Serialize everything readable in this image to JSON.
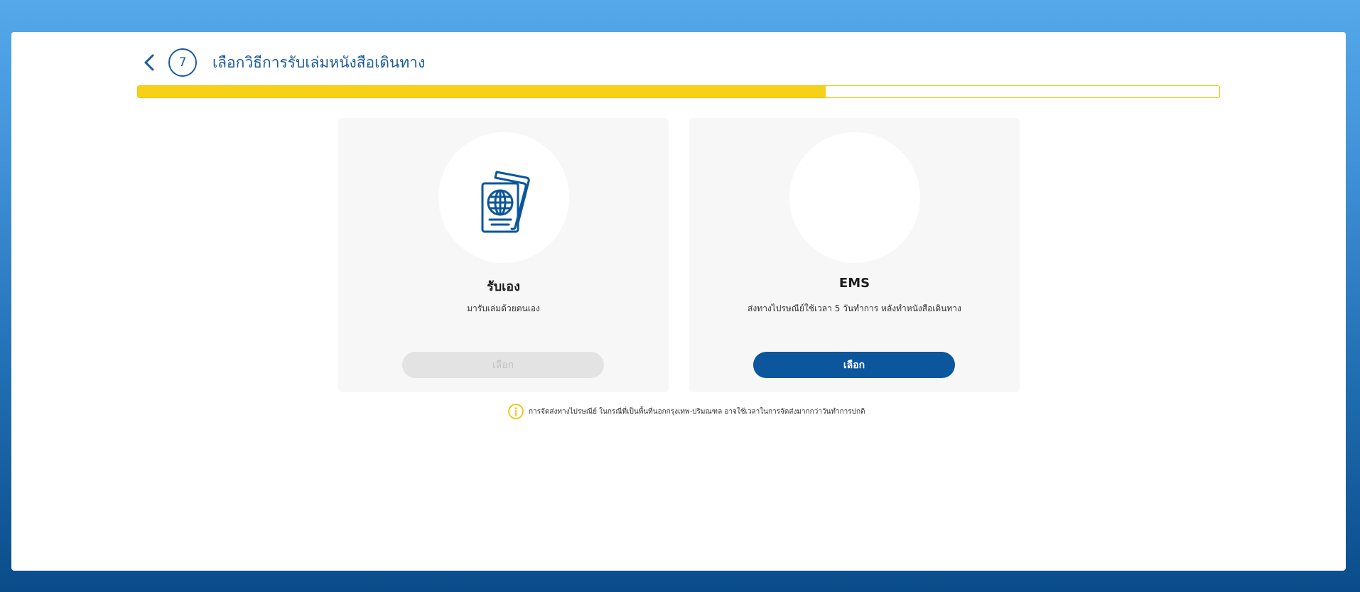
{
  "header": {
    "step_number": "7",
    "title": "เลือกวิธีการรับเล่มหนังสือเดินทาง"
  },
  "progress": {
    "fraction": 0.636,
    "fill_color": "#f7d117",
    "border_color": "#f4c20d"
  },
  "options": [
    {
      "title": "รับเอง",
      "description": "มารับเล่มด้วยตนเอง",
      "button_label": "เลือก",
      "button_state": "disabled",
      "icon": "passport-icon"
    },
    {
      "title": "EMS",
      "description": "ส่งทางไปรษณีย์ใช้เวลา 5 วันทำการ หลังทำหนังสือเดินทาง",
      "button_label": "เลือก",
      "button_state": "enabled"
    }
  ],
  "note": {
    "icon": "info-icon",
    "text": "การจัดส่งทางไปรษณีย์ ในกรณีที่เป็นพื้นที่นอกกรุงเทพ-ปริมณฑล อาจใช้เวลาในการจัดส่งมากกว่าวันทำการปกติ"
  },
  "colors": {
    "primary": "#0b569c",
    "accent": "#f7d117",
    "title_text": "#1a5a9c",
    "info_icon": "#f4c20d"
  }
}
